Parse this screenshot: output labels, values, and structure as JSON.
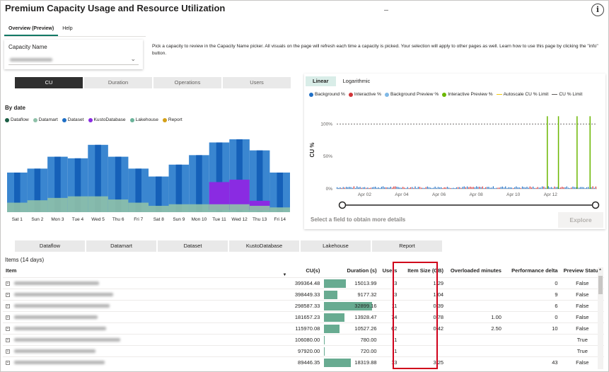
{
  "page": {
    "title": "Premium Capacity Usage and Resource Utilization",
    "info_glyph": "i"
  },
  "nav": {
    "tabs": [
      {
        "label": "Overview (Preview)",
        "active": true
      },
      {
        "label": "Help",
        "active": false
      }
    ]
  },
  "capacity": {
    "label": "Capacity Name",
    "help_text": "Pick a capacity to review in the Capacity Name picker. All visuals on the page will refresh each time a capacity is picked. Your selection will apply to other pages as well. Learn how to use this page by clicking the \"info\" button."
  },
  "metric_tabs": [
    {
      "label": "CU",
      "active": true
    },
    {
      "label": "Duration",
      "active": false
    },
    {
      "label": "Operations",
      "active": false
    },
    {
      "label": "Users",
      "active": false
    }
  ],
  "by_date": {
    "title": "By date",
    "legend": [
      {
        "name": "Dataflow",
        "color": "#1b5e44"
      },
      {
        "name": "Datamart",
        "color": "#8fc1a9"
      },
      {
        "name": "Dataset",
        "color": "#1f6fc5"
      },
      {
        "name": "KustoDatabase",
        "color": "#8a2be2"
      },
      {
        "name": "Lakehouse",
        "color": "#6bb39a"
      },
      {
        "name": "Report",
        "color": "#d4a017"
      }
    ]
  },
  "scale_tabs": [
    {
      "label": "Linear",
      "active": true
    },
    {
      "label": "Logarithmic",
      "active": false
    }
  ],
  "cu_legend": [
    {
      "name": "Background %",
      "color": "#1f6fc5",
      "kind": "dot"
    },
    {
      "name": "Interactive %",
      "color": "#d13438",
      "kind": "dot"
    },
    {
      "name": "Background Preview %",
      "color": "#7fb8e6",
      "kind": "dot"
    },
    {
      "name": "Interactive Preview %",
      "color": "#6bb700",
      "kind": "dot"
    },
    {
      "name": "Autoscale CU % Limit",
      "color": "#f2c811",
      "kind": "line"
    },
    {
      "name": "CU % Limit",
      "color": "#605e5c",
      "kind": "line"
    }
  ],
  "select_field_text": "Select a field to obtain more details",
  "explore_label": "Explore",
  "item_tabs": [
    "Dataflow",
    "Datamart",
    "Dataset",
    "KustoDatabase",
    "Lakehouse",
    "Report"
  ],
  "items": {
    "title": "Items (14 days)",
    "columns": [
      "Item",
      "CU(s)",
      "Duration (s)",
      "Users",
      "Item Size (GB)",
      "Overloaded minutes",
      "Performance delta",
      "Preview Status"
    ],
    "sort_glyph": "▼",
    "rows": [
      {
        "cu": "399364.48",
        "duration": "15013.99",
        "dur_frac": 0.46,
        "users": "3",
        "size": "1.29",
        "overloaded": "",
        "perf": "0",
        "preview": "False",
        "blur_w": 120
      },
      {
        "cu": "398449.33",
        "duration": "9177.32",
        "dur_frac": 0.28,
        "users": "3",
        "size": "1.04",
        "overloaded": "",
        "perf": "9",
        "preview": "False",
        "blur_w": 140
      },
      {
        "cu": "298587.33",
        "duration": "32899.16",
        "dur_frac": 1.0,
        "users": "11",
        "size": "0.39",
        "overloaded": "",
        "perf": "6",
        "preview": "False",
        "blur_w": 135
      },
      {
        "cu": "181657.23",
        "duration": "13928.47",
        "dur_frac": 0.42,
        "users": "74",
        "size": "0.78",
        "overloaded": "1.00",
        "perf": "0",
        "preview": "False",
        "blur_w": 118
      },
      {
        "cu": "115970.08",
        "duration": "10527.26",
        "dur_frac": 0.32,
        "users": "62",
        "size": "0.42",
        "overloaded": "2.50",
        "perf": "10",
        "preview": "False",
        "blur_w": 130
      },
      {
        "cu": "106080.00",
        "duration": "780.00",
        "dur_frac": 0.02,
        "users": "1",
        "size": "",
        "overloaded": "",
        "perf": "",
        "preview": "True",
        "blur_w": 150
      },
      {
        "cu": "97920.00",
        "duration": "720.00",
        "dur_frac": 0.02,
        "users": "1",
        "size": "",
        "overloaded": "",
        "perf": "",
        "preview": "True",
        "blur_w": 115
      },
      {
        "cu": "89446.35",
        "duration": "18319.88",
        "dur_frac": 0.56,
        "users": "13",
        "size": "3.25",
        "overloaded": "",
        "perf": "43",
        "preview": "False",
        "blur_w": 128
      }
    ]
  },
  "chart_data": [
    {
      "type": "area",
      "title": "By date",
      "categories": [
        "Sat 1",
        "Sun 2",
        "Mon 3",
        "Tue 4",
        "Wed 5",
        "Thu 6",
        "Fri 7",
        "Sat 8",
        "Sun 9",
        "Mon 10",
        "Tue 11",
        "Wed 12",
        "Thu 13",
        "Fri 14"
      ],
      "series": [
        {
          "name": "Dataset",
          "values": [
            0.5,
            0.55,
            0.7,
            0.68,
            0.85,
            0.7,
            0.55,
            0.45,
            0.6,
            0.72,
            0.88,
            0.92,
            0.78,
            0.5
          ]
        },
        {
          "name": "Lakehouse",
          "values": [
            0.12,
            0.15,
            0.18,
            0.2,
            0.2,
            0.16,
            0.12,
            0.08,
            0.1,
            0.1,
            0.1,
            0.1,
            0.08,
            0.06
          ]
        },
        {
          "name": "KustoDatabase",
          "values": [
            0,
            0,
            0,
            0,
            0,
            0,
            0,
            0,
            0,
            0,
            0.35,
            0.38,
            0.12,
            0
          ]
        }
      ],
      "legend_position": "top-left"
    },
    {
      "type": "bar",
      "ylabel": "CU %",
      "y_ticks": [
        "0%",
        "50%",
        "100%"
      ],
      "x_ticks": [
        "Apr 02",
        "Apr 04",
        "Apr 06",
        "Apr 08",
        "Apr 10",
        "Apr 12"
      ],
      "ylim": [
        0,
        120
      ],
      "limit_line": 100,
      "spikes": [
        {
          "series": "Interactive Preview %",
          "day": 11.3,
          "value": 112
        },
        {
          "series": "Interactive Preview %",
          "day": 11.9,
          "value": 112
        },
        {
          "series": "Interactive Preview %",
          "day": 12.9,
          "value": 112
        },
        {
          "series": "Interactive Preview %",
          "day": 13.6,
          "value": 112
        }
      ]
    }
  ]
}
